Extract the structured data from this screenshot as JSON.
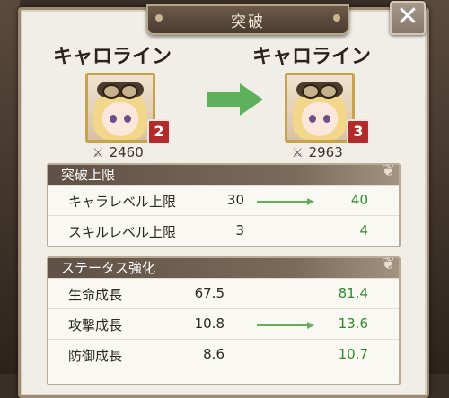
{
  "dialog": {
    "title": "突破",
    "close_label": "✕"
  },
  "before": {
    "name": "キャロライン",
    "level": "2",
    "power": "2460"
  },
  "after": {
    "name": "キャロライン",
    "level": "3",
    "power": "2963"
  },
  "limit_section": {
    "title": "突破上限",
    "rows": [
      {
        "label": "キャラレベル上限",
        "before": "30",
        "after": "40"
      },
      {
        "label": "スキルレベル上限",
        "before": "3",
        "after": "4"
      }
    ]
  },
  "status_section": {
    "title": "ステータス強化",
    "rows": [
      {
        "label": "生命成長",
        "before": "67.5",
        "after": "81.4"
      },
      {
        "label": "攻撃成長",
        "before": "10.8",
        "after": "13.6"
      },
      {
        "label": "防御成長",
        "before": "8.6",
        "after": "10.7"
      }
    ]
  },
  "colors": {
    "arrow": "#5fb05a",
    "increase": "#2f8a2a",
    "badge": "#b22a2a"
  },
  "icons": {
    "power": "crossed-swords-icon",
    "arrow": "right-arrow-icon"
  }
}
